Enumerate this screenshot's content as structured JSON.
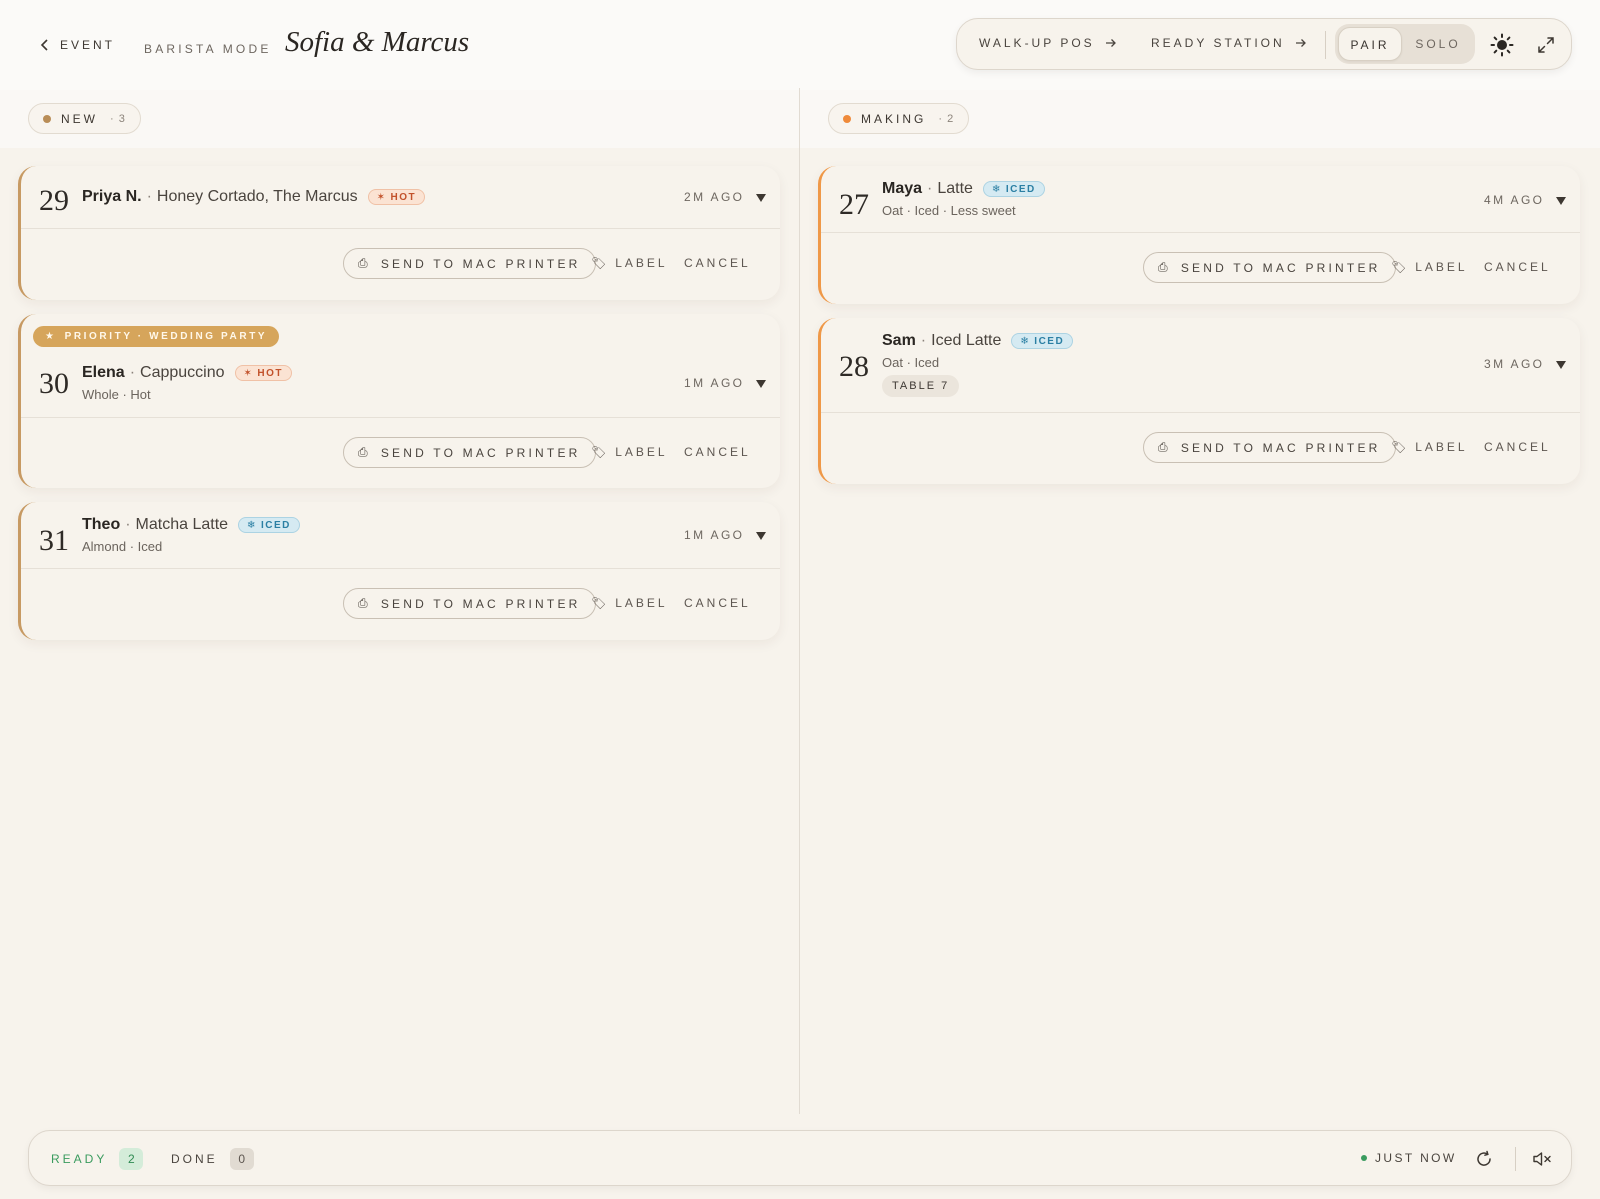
{
  "header": {
    "back_label": "EVENT",
    "mode_label": "BARISTA MODE",
    "event_title": "Sofia & Marcus",
    "links": {
      "walkup": "WALK-UP POS",
      "ready_station": "READY STATION"
    },
    "toggle": {
      "pair": "PAIR",
      "solo": "SOLO",
      "selected": "PAIR"
    },
    "icons": [
      "arrow-right-icon",
      "sun-icon",
      "expand-icon",
      "chevron-left-icon"
    ]
  },
  "columns": {
    "new": {
      "label": "NEW",
      "count": "· 3",
      "dot_color": "#b98d57"
    },
    "making": {
      "label": "MAKING",
      "count": "· 2",
      "dot_color": "#ef8a3a"
    }
  },
  "actions": {
    "send": "SEND TO MAC PRINTER",
    "label": "LABEL",
    "cancel": "CANCEL"
  },
  "orders": {
    "new": [
      {
        "number": "29",
        "customer": "Priya N.",
        "drink": "Honey Cortado, The Marcus",
        "temp": "HOT",
        "modifiers": "",
        "age": "2M AGO"
      },
      {
        "number": "30",
        "priority": "PRIORITY · WEDDING PARTY",
        "customer": "Elena",
        "drink": "Cappuccino",
        "temp": "HOT",
        "modifiers": "Whole · Hot",
        "age": "1M AGO"
      },
      {
        "number": "31",
        "customer": "Theo",
        "drink": "Matcha Latte",
        "temp": "ICED",
        "modifiers": "Almond · Iced",
        "age": "1M AGO"
      }
    ],
    "making": [
      {
        "number": "27",
        "customer": "Maya",
        "drink": "Latte",
        "temp": "ICED",
        "modifiers": "Oat · Iced · Less sweet",
        "age": "4M AGO"
      },
      {
        "number": "28",
        "customer": "Sam",
        "drink": "Iced Latte",
        "temp": "ICED",
        "modifiers": "Oat · Iced",
        "table": "TABLE 7",
        "age": "3M AGO"
      }
    ]
  },
  "footer": {
    "ready_label": "READY",
    "ready_count": "2",
    "done_label": "DONE",
    "done_count": "0",
    "status": "JUST NOW"
  },
  "colors": {
    "new_accent": "#c79a63",
    "making_accent": "#ef9847",
    "priority": "#d6a55b",
    "ready_green": "#3a9b5e"
  }
}
